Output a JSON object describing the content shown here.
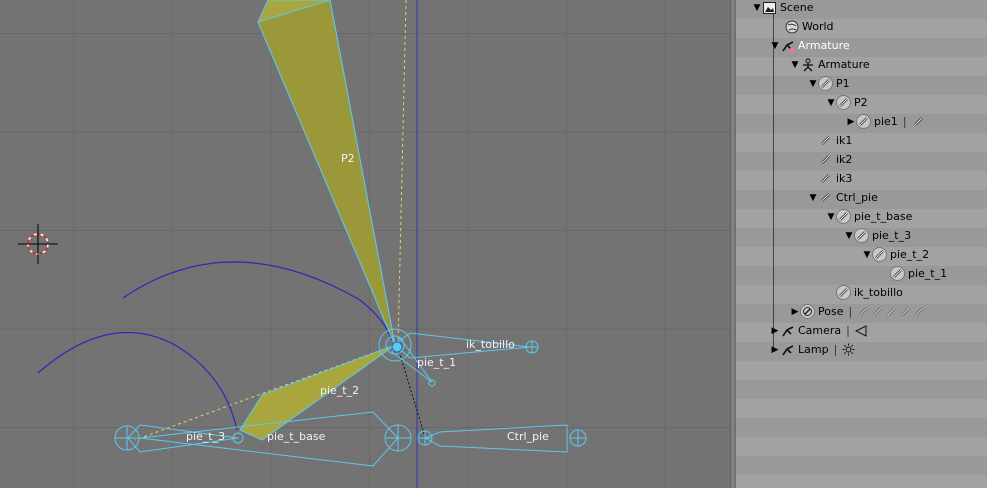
{
  "viewport": {
    "bone_labels": {
      "p2": "P2",
      "ik_tobillo": "ik_tobillo",
      "pie_t_1": "pie_t_1",
      "pie_t_2": "pie_t_2",
      "pie_t_3": "pie_t_3",
      "pie_t_base": "pie_t_base",
      "ctrl_pie": "Ctrl_pie"
    }
  },
  "outliner": {
    "rows": [
      {
        "id": "scene",
        "label": "Scene",
        "icon": "scene-icon"
      },
      {
        "id": "world",
        "label": "World",
        "icon": "world-icon"
      },
      {
        "id": "armature-object",
        "label": "Armature",
        "icon": "armature-object-icon"
      },
      {
        "id": "armature-data",
        "label": "Armature",
        "icon": "armature-data-icon"
      },
      {
        "id": "p1",
        "label": "P1",
        "icon": "bone-icon"
      },
      {
        "id": "p2",
        "label": "P2",
        "icon": "bone-icon"
      },
      {
        "id": "pie1",
        "label": "pie1",
        "icon": "bone-icon"
      },
      {
        "id": "ik1",
        "label": "ik1",
        "icon": "bone-icon"
      },
      {
        "id": "ik2",
        "label": "ik2",
        "icon": "bone-icon"
      },
      {
        "id": "ik3",
        "label": "ik3",
        "icon": "bone-icon"
      },
      {
        "id": "ctrl-pie",
        "label": "Ctrl_pie",
        "icon": "bone-icon"
      },
      {
        "id": "pie-t-base",
        "label": "pie_t_base",
        "icon": "bone-icon"
      },
      {
        "id": "pie-t-3",
        "label": "pie_t_3",
        "icon": "bone-icon"
      },
      {
        "id": "pie-t-2",
        "label": "pie_t_2",
        "icon": "bone-icon"
      },
      {
        "id": "pie-t-1",
        "label": "pie_t_1",
        "icon": "bone-icon"
      },
      {
        "id": "ik-tobillo",
        "label": "ik_tobillo",
        "icon": "bone-icon"
      },
      {
        "id": "pose",
        "label": "Pose",
        "icon": "pose-icon"
      },
      {
        "id": "camera",
        "label": "Camera",
        "icon": "camera-object-icon"
      },
      {
        "id": "lamp",
        "label": "Lamp",
        "icon": "lamp-object-icon"
      }
    ]
  },
  "colors": {
    "viewport_bg": "#737373",
    "bone_fill": "#a8a63c",
    "bone_outline": "#5ec8f0",
    "arc": "#2a2ab8",
    "dashed": "#e8d060",
    "outliner_bg": "#999999",
    "selected_text": "#ffffff"
  }
}
